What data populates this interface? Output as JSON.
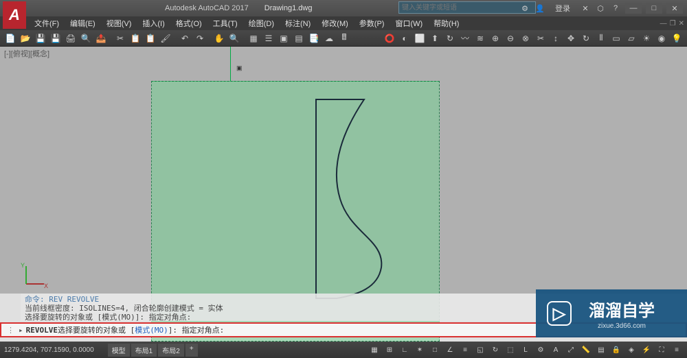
{
  "app": {
    "name": "Autodesk AutoCAD 2017",
    "document": "Drawing1.dwg",
    "search_placeholder": "键入关键字或短语",
    "login": "登录"
  },
  "menu": {
    "items": [
      {
        "label": "文件(F)"
      },
      {
        "label": "编辑(E)"
      },
      {
        "label": "视图(V)"
      },
      {
        "label": "插入(I)"
      },
      {
        "label": "格式(O)"
      },
      {
        "label": "工具(T)"
      },
      {
        "label": "绘图(D)"
      },
      {
        "label": "标注(N)"
      },
      {
        "label": "修改(M)"
      },
      {
        "label": "参数(P)"
      },
      {
        "label": "窗口(W)"
      },
      {
        "label": "帮助(H)"
      }
    ]
  },
  "viewport": {
    "label": "[-][俯视][概念]"
  },
  "command_history": {
    "line1": "命令: REV REVOLVE",
    "line2": "当前线框密度:  ISOLINES=4, 闭合轮廓创建模式 = 实体",
    "line3": "选择要旋转的对象或 [模式(MO)]: 指定对角点:"
  },
  "commandline": {
    "prefix": "▸",
    "cmd": "REVOLVE",
    "text1": " 选择要旋转的对象或 [",
    "option": "模式(MO)",
    "text2": "]: 指定对角点:"
  },
  "status": {
    "coords": "1279.4204, 707.1590, 0.0000",
    "tabs": [
      "模型",
      "布局1",
      "布局2",
      "+"
    ]
  },
  "watermark": {
    "text": "溜溜自学",
    "url": "zixue.3d66.com"
  },
  "icons": {
    "app": "A",
    "minimize": "—",
    "maximize": "□",
    "close": "✕"
  }
}
